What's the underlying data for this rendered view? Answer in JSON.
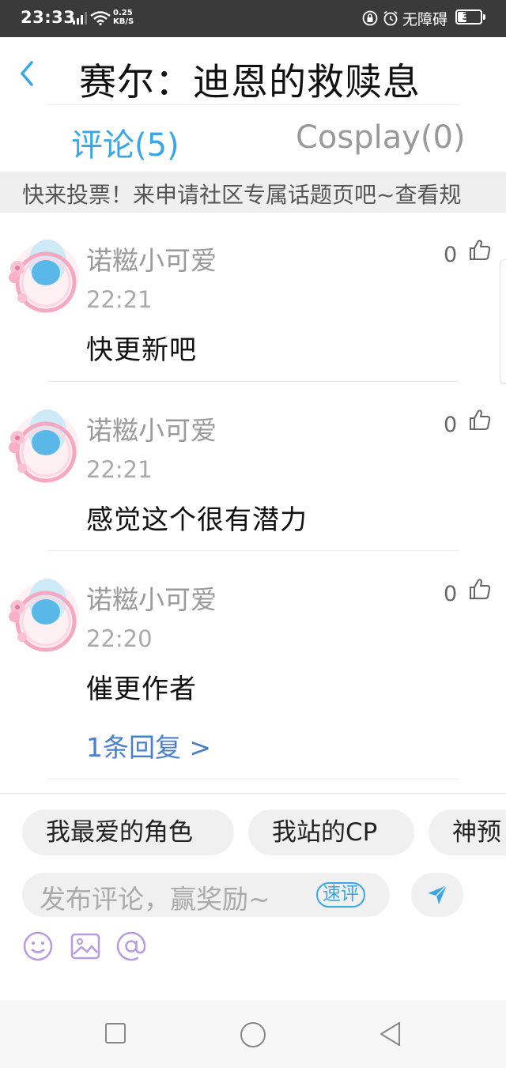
{
  "status_bar": {
    "time": "23:33",
    "net_speed_value": "0.25",
    "net_speed_unit": "KB/S",
    "accessibility": "无障碍",
    "battery": "38"
  },
  "header": {
    "title": "赛尔：迪恩的救赎息"
  },
  "tabs": [
    {
      "label": "评论(5)",
      "active": true
    },
    {
      "label": "Cosplay(0)",
      "active": false
    }
  ],
  "notice": {
    "text": "快来投票！来申请社区专属话题页吧~查看规"
  },
  "comments": [
    {
      "user": "诺糍小可爱",
      "time": "22:21",
      "text": "快更新吧",
      "likes": "0"
    },
    {
      "user": "诺糍小可爱",
      "time": "22:21",
      "text": "感觉这个很有潜力",
      "likes": "0"
    },
    {
      "user": "诺糍小可爱",
      "time": "22:20",
      "text": "催更作者",
      "likes": "0",
      "reply_link": "1条回复 >"
    }
  ],
  "composer": {
    "chips": [
      "我最爱的角色",
      "我站的CP",
      "神预"
    ],
    "placeholder": "发布评论，赢奖励~",
    "quick_badge": "速评"
  },
  "colors": {
    "accent": "#3aa6e8",
    "reply_link": "#4a7fd0",
    "status_bar": "#3a3a3a",
    "tool_icon": "#b89be0"
  }
}
